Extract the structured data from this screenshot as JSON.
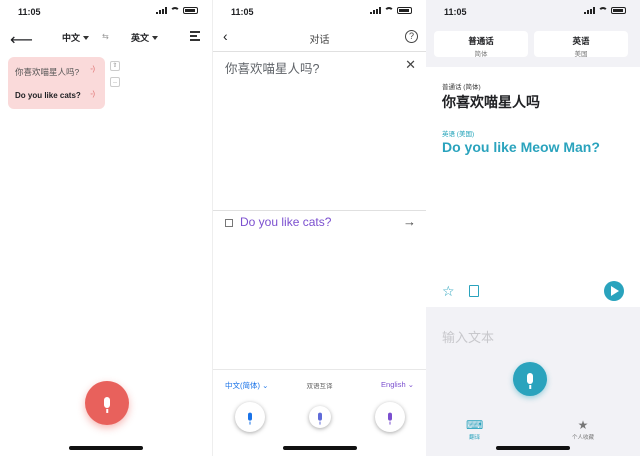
{
  "status_time": "11:05",
  "panel1": {
    "source_lang": "中文",
    "swap_glyph": "⇆",
    "target_lang": "英文",
    "query": "你喜欢喵星人吗?",
    "answer": "Do you like cats?",
    "speaker_glyph": "◦)",
    "side_icon_1": "⇧",
    "side_icon_2": "‥",
    "colors": {
      "bubble": "#fadada",
      "mic": "#e8615c"
    }
  },
  "panel2": {
    "back_glyph": "‹",
    "title": "对话",
    "help_glyph": "?",
    "input_text": "你喜欢喵星人吗?",
    "close_glyph": "✕",
    "output_text": "Do you like cats?",
    "go_glyph": "→",
    "left_lang": "中文(简体) ⌄",
    "mode_label": "双语互译",
    "right_lang": "English ⌄",
    "colors": {
      "blue": "#1a73e8",
      "purple": "#7b4fcf"
    }
  },
  "panel3": {
    "tab_left": {
      "title": "普通话",
      "sub": "简体"
    },
    "tab_right": {
      "title": "英语",
      "sub": "美国"
    },
    "source_label": "普通话 (简体)",
    "source_text": "你喜欢喵星人吗",
    "target_label": "英语 (美国)",
    "target_text": "Do you like Meow Man?",
    "star_glyph": "☆",
    "input_placeholder": "输入文本",
    "nav_translate": "翻译",
    "nav_favorites": "个人收藏",
    "nav_fav_glyph": "★",
    "nav_trans_glyph": "⌨",
    "colors": {
      "accent": "#2aa3bd"
    }
  }
}
